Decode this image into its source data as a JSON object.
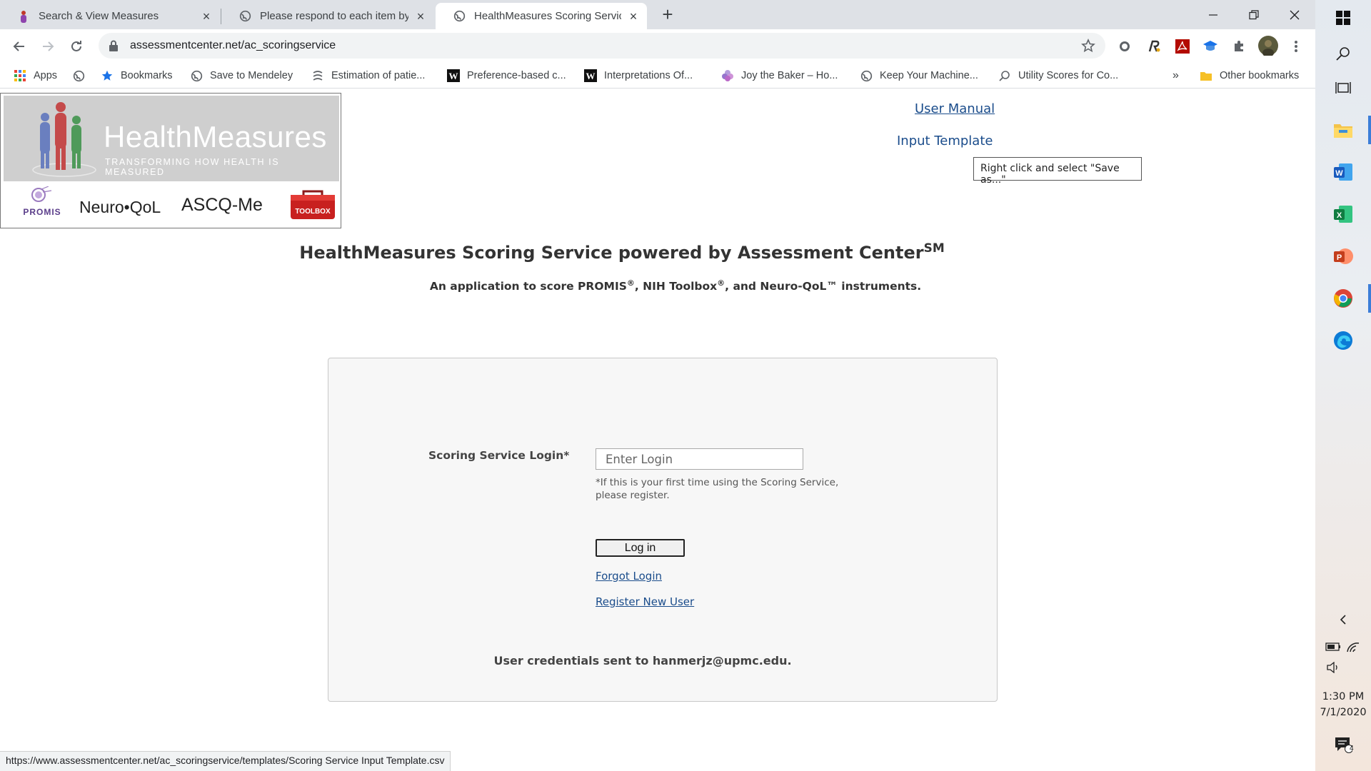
{
  "browser": {
    "tabs": [
      {
        "title": "Search & View Measures",
        "active": false
      },
      {
        "title": "Please respond to each item by c",
        "active": false
      },
      {
        "title": "HealthMeasures Scoring Service",
        "active": true
      }
    ],
    "url": "assessmentcenter.net/ac_scoringservice",
    "bookmarks": [
      "Apps",
      "Bookmarks",
      "Save to Mendeley",
      "Estimation of patie...",
      "Preference-based c...",
      "Interpretations Of...",
      "Joy the Baker – Ho...",
      "Keep Your Machine...",
      "Utility Scores for Co..."
    ],
    "overflow": "»",
    "other_bookmarks": "Other bookmarks",
    "status_url": "https://www.assessmentcenter.net/ac_scoringservice/templates/Scoring Service Input Template.csv"
  },
  "logo": {
    "brand": "HealthMeasures",
    "tagline": "TRANSFORMING HOW HEALTH IS MEASURED",
    "promis": "PROMIS",
    "neuroqol": "Neuro•QoL",
    "ascq": "ASCQ-Me",
    "toolbox": "TOOLBOX"
  },
  "header": {
    "user_manual": "User Manual",
    "input_template": "Input Template",
    "tooltip": "Right click and select \"Save as...\""
  },
  "main": {
    "title": "HealthMeasures Scoring Service powered by Assessment Center",
    "title_sup": "SM",
    "subtitle_a": "An application to score PROMIS",
    "subtitle_b": ", NIH Toolbox",
    "subtitle_c": ", and Neuro-QoL™ instruments.",
    "reg": "®"
  },
  "login": {
    "label": "Scoring Service Login*",
    "placeholder": "Enter Login",
    "note": "*If this is your first time using the Scoring Service, please register.",
    "button": "Log in",
    "forgot": "Forgot Login",
    "register": "Register New User",
    "credentials": "User credentials sent to hanmerjz@upmc.edu."
  },
  "taskbar": {
    "time": "1:30 PM",
    "date": "7/1/2020",
    "notifications": "4"
  },
  "colors": {
    "link": "#1a4c8b",
    "tabstrip": "#dee1e6",
    "panel": "#f7f7f7"
  }
}
